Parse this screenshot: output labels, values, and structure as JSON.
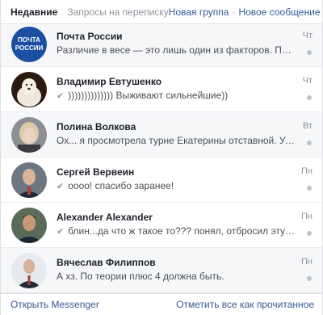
{
  "header": {
    "tab_recent": "Недавние",
    "tab_requests": "Запросы на переписку",
    "new_group": "Новая группа",
    "separator": "·",
    "new_message": "Новое сообщение"
  },
  "conversations": [
    {
      "name": "Почта России",
      "snippet": "Различие в весе — это лишь один из факторов. При сос...",
      "time": "Чт",
      "reply": false,
      "avatar_text": [
        "ПОЧТА",
        "РОССИИ"
      ],
      "read": false
    },
    {
      "name": "Владимир Евтушенко",
      "snippet": ")))))))))))))) Выживают сильнейшие))",
      "time": "Чт",
      "reply": true,
      "read": true
    },
    {
      "name": "Полина Волкова",
      "snippet": "Ох... я просмотрела турне Екатерины отставной. Уведе...",
      "time": "Вт",
      "reply": false,
      "read": false
    },
    {
      "name": "Сергей Вервеин",
      "snippet": "оооо! спасибо заранее!",
      "time": "Пн",
      "reply": true,
      "read": true
    },
    {
      "name": "Alexander Alexander",
      "snippet": "блин...да что ж такое то??? понял, отбросил эту идею.",
      "time": "Пн",
      "reply": true,
      "read": true
    },
    {
      "name": "Вячеслав Филиппов",
      "snippet": "А хз. По теории плюс 4 должна быть.",
      "time": "Пн",
      "reply": false,
      "read": false
    }
  ],
  "footer": {
    "open_messenger": "Открыть Messenger",
    "mark_all_read": "Отметить все как прочитанное"
  },
  "colors": {
    "link": "#365899",
    "muted": "#90949c",
    "pochta_blue": "#1c4fa1",
    "unread_bg": "#f6f7f9"
  }
}
